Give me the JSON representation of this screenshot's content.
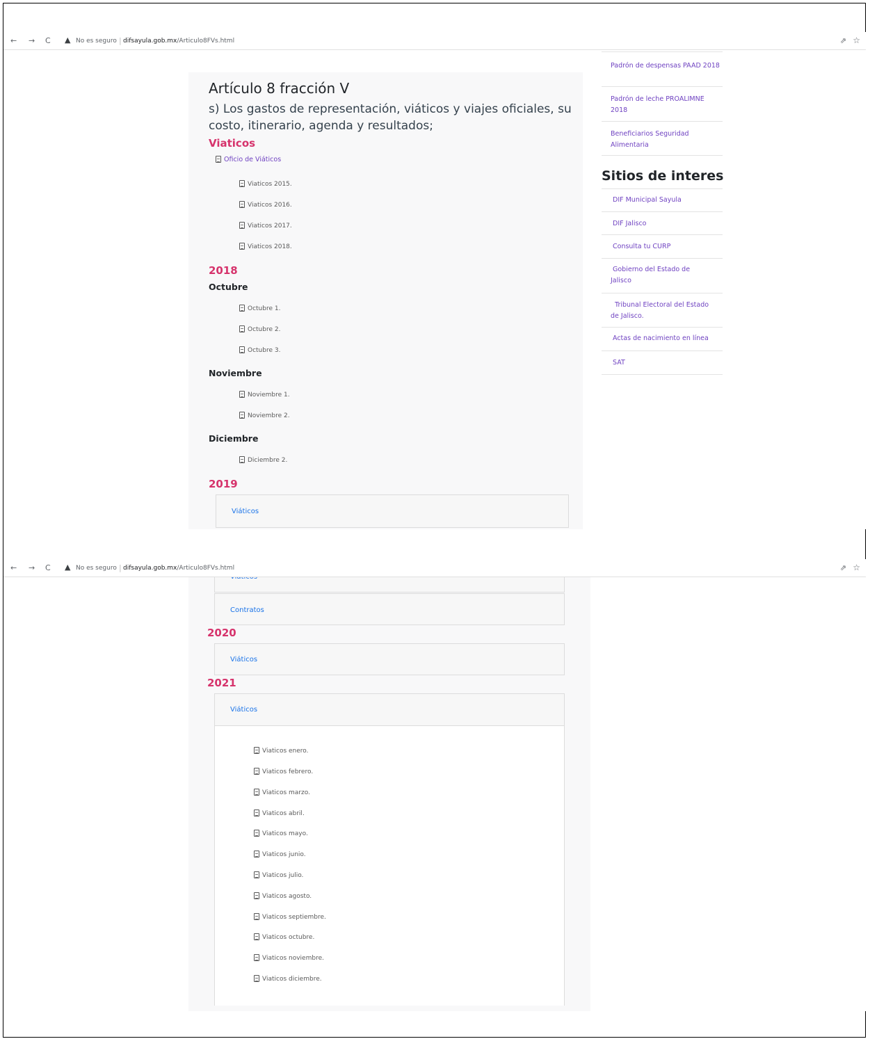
{
  "browser": {
    "not_secure": "No es seguro",
    "url_domain": "difsayula.gob.mx",
    "url_path": "/Articulo8FVs.html"
  },
  "content": {
    "title": "Artículo 8 fracción V",
    "subtitle": "s) Los gastos de representación, viáticos y viajes oficiales, su costo, itinerario, agenda y resultados;",
    "viaticos_heading": "Viaticos",
    "oficio_link": "Oficio de Viáticos",
    "viaticos_years": [
      "Viaticos 2015.",
      "Viaticos 2016.",
      "Viaticos 2017.",
      "Viaticos 2018."
    ],
    "year_2018": "2018",
    "octubre": "Octubre",
    "octubre_docs": [
      "Octubre 1.",
      "Octubre 2.",
      "Octubre 3."
    ],
    "noviembre": "Noviembre",
    "noviembre_docs": [
      "Noviembre 1.",
      "Noviembre 2."
    ],
    "diciembre": "Diciembre",
    "diciembre_docs": [
      "Diciembre 2."
    ],
    "year_2019": "2019",
    "acc_2019_viaticos": "Viáticos",
    "acc_2019_viaticos_partial": "Viaticos",
    "acc_2019_contratos": "Contratos",
    "year_2020": "2020",
    "acc_2020_viaticos": "Viáticos",
    "year_2021": "2021",
    "acc_2021_viaticos": "Viáticos",
    "viaticos_2021_docs": [
      "Viaticos enero.",
      "Viaticos febrero.",
      "Viaticos marzo.",
      "Viaticos abril.",
      "Viaticos mayo.",
      "Viaticos junio.",
      "Viaticos julio.",
      "Viaticos agosto.",
      "Viaticos septiembre.",
      "Viaticos octubre.",
      "Viaticos noviembre.",
      "Viaticos diciembre."
    ]
  },
  "sidebar": {
    "padrones": [
      "Padrón de despensas PAAD 2018",
      "Padrón de leche PROALIMNE 2018",
      "Beneficiarios Seguridad Alimentaria"
    ],
    "sites_title": "Sitios de interes",
    "sites": [
      "DIF Municipal Sayula",
      "DIF Jalisco",
      "Consulta tu CURP",
      "Gobierno del Estado de Jalisco",
      " Tribunal Electoral del Estado de Jalisco.",
      "Actas de nacimiento en línea",
      "SAT"
    ]
  },
  "colors": {
    "accent_pink": "#d6336c",
    "link_purple": "#6f42c1",
    "link_blue": "#1a73e8"
  }
}
